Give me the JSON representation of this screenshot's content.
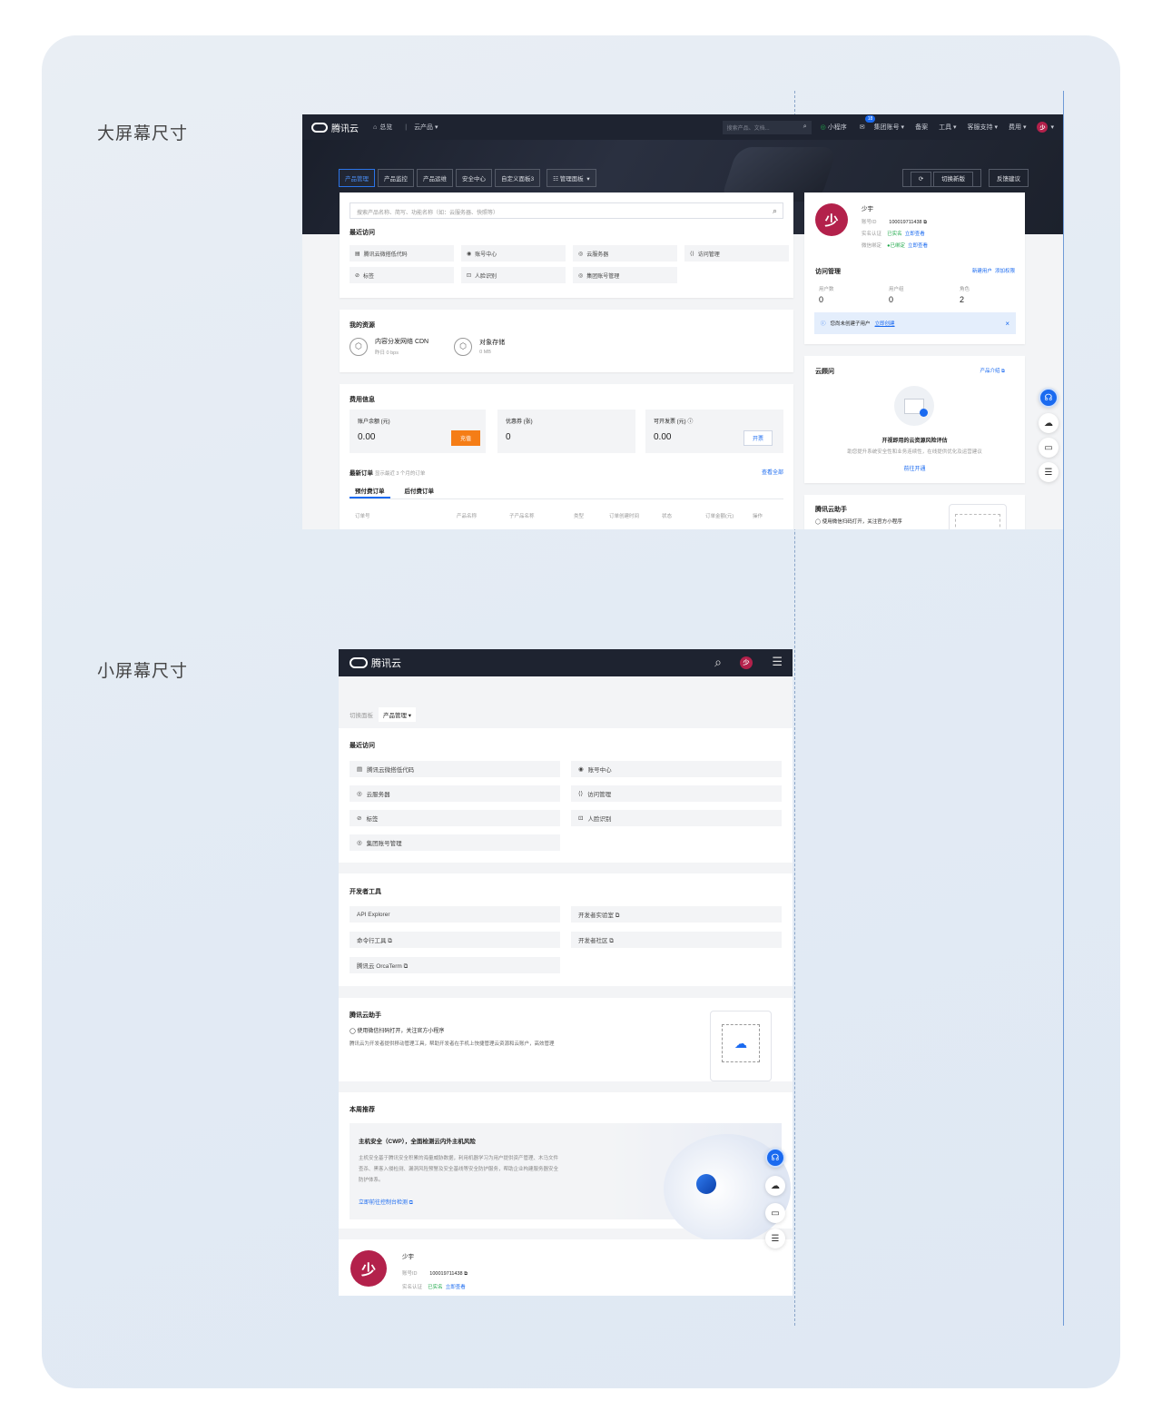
{
  "section_titles": {
    "large": "大屏幕尺寸",
    "small": "小屏幕尺寸"
  },
  "brand": "腾讯云",
  "large": {
    "topbar": {
      "home": "总览",
      "products": "云产品",
      "search_placeholder": "搜索产品、文档...",
      "mini": "小程序",
      "badge": "18",
      "items": [
        "集团账号",
        "备案",
        "工具",
        "客服支持",
        "费用"
      ],
      "avatar": "少"
    },
    "tabs": [
      "产品管理",
      "产品监控",
      "产品运维",
      "安全中心",
      "自定义面板3",
      "管理面板"
    ],
    "hero_buttons": [
      "切换新版",
      "反馈建议"
    ],
    "search_placeholder": "搜索产品名称、简写、功能名称（如：云服务器、快照等）",
    "recent": {
      "title": "最近访问",
      "items": [
        "腾讯云微搭低代码",
        "账号中心",
        "云服务器",
        "访问管理",
        "标签",
        "人脸识别",
        "集团账号管理"
      ]
    },
    "resources": {
      "title": "我的资源",
      "items": [
        {
          "name": "内容分发网络 CDN",
          "sub": "昨日 0 bps"
        },
        {
          "name": "对象存储",
          "sub": "0 MB"
        }
      ]
    },
    "fees": {
      "title": "费用信息",
      "balance_label": "账户余额 (元)",
      "balance": "0.00",
      "recharge": "充值",
      "coupon_label": "优惠券 (张)",
      "coupon": "0",
      "invoice_label": "可开发票 (元)",
      "invoice": "0.00",
      "invoice_btn": "开票"
    },
    "orders": {
      "title": "最新订单",
      "note": "显示最近 3 个月的订单",
      "view_all": "查看全部",
      "tabs": [
        "预付费订单",
        "后付费订单"
      ],
      "columns": [
        "订单号",
        "产品名称",
        "子产品名称",
        "类型",
        "订单创建时间",
        "状态",
        "订单金额(元)",
        "操作"
      ]
    },
    "profile": {
      "name": "少宇",
      "account_label": "账号ID",
      "account": "100019711438",
      "verify_label": "实名认证",
      "verify": "已实名",
      "verify_link": "立即查看",
      "wechat_label": "微信绑定",
      "wechat": "已绑定",
      "wechat_link": "立即查看"
    },
    "access": {
      "title": "访问管理",
      "new_user": "新建用户",
      "grant": "添加权限",
      "stats": [
        {
          "label": "用户数",
          "value": "0"
        },
        {
          "label": "用户组",
          "value": "0"
        },
        {
          "label": "角色",
          "value": "2"
        }
      ],
      "notice": "您尚未创建子用户",
      "notice_link": "立即创建"
    },
    "advisor": {
      "title": "云顾问",
      "intro": "产品介绍",
      "heading": "开视即用的云资源风险评估",
      "desc": "助您提升系统安全性和业务连续性，在线提供优化及运营建议",
      "cta": "前往开通"
    },
    "assistant": {
      "title": "腾讯云助手",
      "desc": "使用微信扫码打开，关注官方小程序"
    }
  },
  "small": {
    "switch_label": "切换面板",
    "switch_value": "产品管理",
    "recent": {
      "title": "最近访问",
      "items": [
        "腾讯云微搭低代码",
        "账号中心",
        "云服务器",
        "访问管理",
        "标签",
        "人脸识别",
        "集团账号管理"
      ]
    },
    "devtools": {
      "title": "开发者工具",
      "items": [
        "API Explorer",
        "开发者实验室 ⧉",
        "命令行工具 ⧉",
        "开发者社区 ⧉",
        "腾讯云 OrcaTerm ⧉"
      ]
    },
    "assistant": {
      "title": "腾讯云助手",
      "line1": "使用微信扫码打开，关注官方小程序",
      "line2": "腾讯云为开发者提供移动管理工具，帮助开发者在手机上快捷管理云资源和云账户，高效管理"
    },
    "weekly": {
      "title": "本周推荐",
      "heading": "主机安全（CWP），全面检测云内外主机风险",
      "desc": "主机安全基于腾讯安全积累的海量威胁数据，利用机器学习为用户提供资产管理、木马文件查杀、黑客入侵检测、漏洞风险预警及安全基线等安全防护服务，帮助企业构建服务器安全防护体系。",
      "link": "立即前往控制台检测 ⧉"
    },
    "profile": {
      "name": "少宇",
      "account_label": "账号ID",
      "account": "100019711438",
      "verify_label": "实名认证",
      "verify": "已实名",
      "verify_link": "立即查看",
      "avatar": "少"
    }
  },
  "colors": {
    "topbar": "#1e2330",
    "accent": "#1a6af0",
    "avatar": "#b3214b",
    "recharge": "#f57d16",
    "success": "#1fa94a"
  }
}
